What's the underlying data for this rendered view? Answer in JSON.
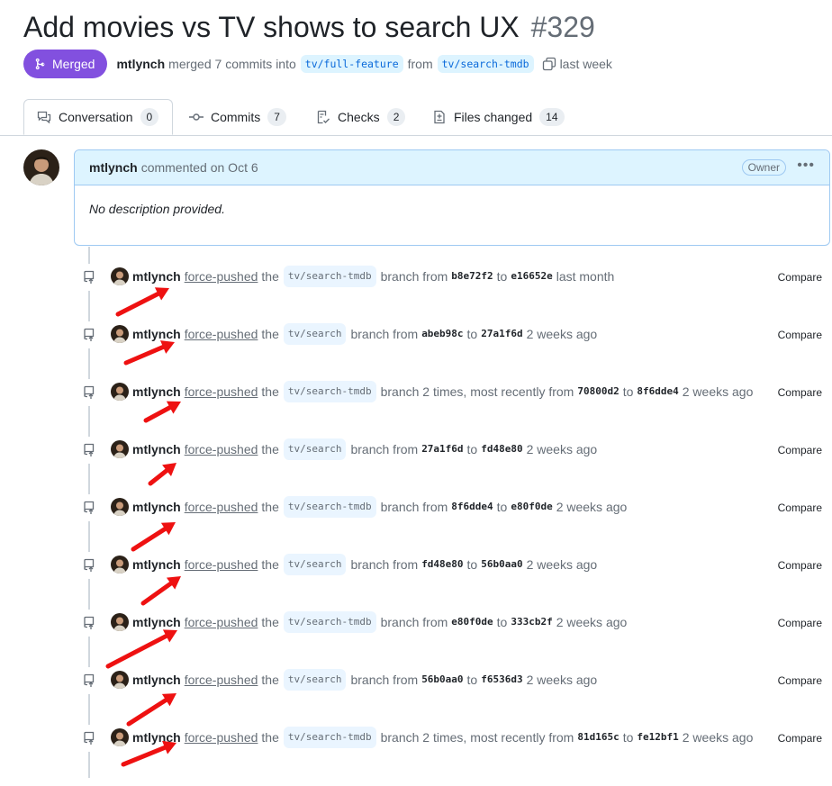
{
  "pr": {
    "title": "Add movies vs TV shows to search UX",
    "number": "#329",
    "state": "Merged",
    "author": "mtlynch",
    "summary": "merged 7 commits into",
    "base_branch": "tv/full-feature",
    "from_word": "from",
    "head_branch": "tv/search-tmdb",
    "when": "last week"
  },
  "tabs": [
    {
      "label": "Conversation",
      "count": "0",
      "icon": "comment-discussion-icon"
    },
    {
      "label": "Commits",
      "count": "7",
      "icon": "git-commit-icon"
    },
    {
      "label": "Checks",
      "count": "2",
      "icon": "checklist-icon"
    },
    {
      "label": "Files changed",
      "count": "14",
      "icon": "file-diff-icon"
    }
  ],
  "comment": {
    "author": "mtlynch",
    "meta": "commented on Oct 6",
    "role": "Owner",
    "body": "No description provided."
  },
  "events": [
    {
      "user": "mtlynch",
      "action": "force-pushed",
      "the": "the",
      "branch": "tv/search-tmdb",
      "mid": "branch from",
      "from_sha": "b8e72f2",
      "to": "to",
      "to_sha": "e16652e",
      "when": "last month",
      "compare": "Compare"
    },
    {
      "user": "mtlynch",
      "action": "force-pushed",
      "the": "the",
      "branch": "tv/search",
      "mid": "branch from",
      "from_sha": "abeb98c",
      "to": "to",
      "to_sha": "27a1f6d",
      "when": "2 weeks ago",
      "compare": "Compare"
    },
    {
      "user": "mtlynch",
      "action": "force-pushed",
      "the": "the",
      "branch": "tv/search-tmdb",
      "mid": "branch 2 times, most recently from",
      "from_sha": "70800d2",
      "to": "to",
      "to_sha": "8f6dde4",
      "when": "2 weeks ago",
      "compare": "Compare"
    },
    {
      "user": "mtlynch",
      "action": "force-pushed",
      "the": "the",
      "branch": "tv/search",
      "mid": "branch from",
      "from_sha": "27a1f6d",
      "to": "to",
      "to_sha": "fd48e80",
      "when": "2 weeks ago",
      "compare": "Compare"
    },
    {
      "user": "mtlynch",
      "action": "force-pushed",
      "the": "the",
      "branch": "tv/search-tmdb",
      "mid": "branch from",
      "from_sha": "8f6dde4",
      "to": "to",
      "to_sha": "e80f0de",
      "when": "2 weeks ago",
      "compare": "Compare"
    },
    {
      "user": "mtlynch",
      "action": "force-pushed",
      "the": "the",
      "branch": "tv/search",
      "mid": "branch from",
      "from_sha": "fd48e80",
      "to": "to",
      "to_sha": "56b0aa0",
      "when": "2 weeks ago",
      "compare": "Compare"
    },
    {
      "user": "mtlynch",
      "action": "force-pushed",
      "the": "the",
      "branch": "tv/search-tmdb",
      "mid": "branch from",
      "from_sha": "e80f0de",
      "to": "to",
      "to_sha": "333cb2f",
      "when": "2 weeks ago",
      "compare": "Compare"
    },
    {
      "user": "mtlynch",
      "action": "force-pushed",
      "the": "the",
      "branch": "tv/search",
      "mid": "branch from",
      "from_sha": "56b0aa0",
      "to": "to",
      "to_sha": "f6536d3",
      "when": "2 weeks ago",
      "compare": "Compare"
    },
    {
      "user": "mtlynch",
      "action": "force-pushed",
      "the": "the",
      "branch": "tv/search-tmdb",
      "mid": "branch 2 times, most recently from",
      "from_sha": "81d165c",
      "to": "to",
      "to_sha": "fe12bf1",
      "when": "2 weeks ago",
      "compare": "Compare"
    }
  ],
  "colors": {
    "merged": "#8250df",
    "annotation_arrow": "#ee1111",
    "comment_header": "#ddf4ff"
  }
}
